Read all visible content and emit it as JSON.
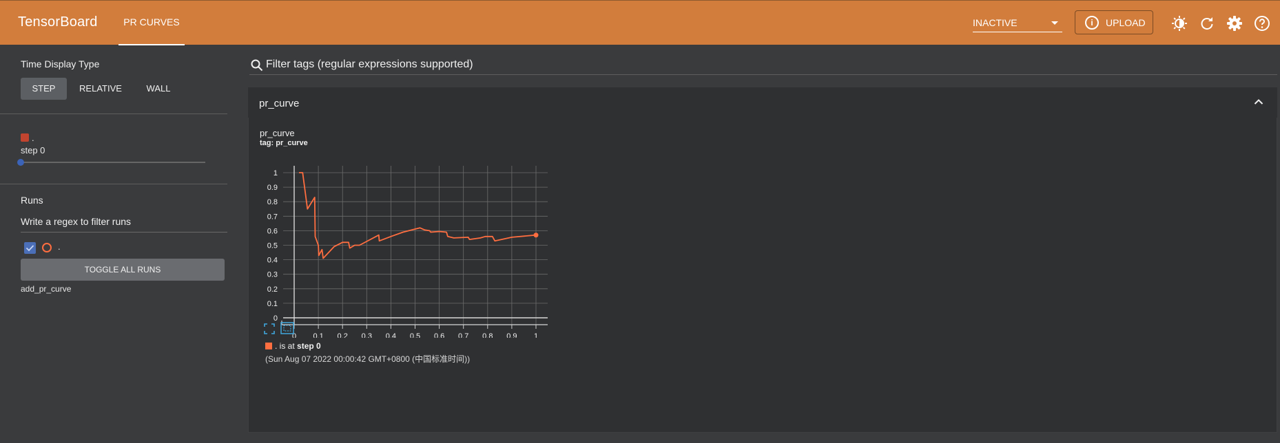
{
  "header": {
    "brand": "TensorBoard",
    "tab_label": "PR CURVES",
    "run_selector_value": "INACTIVE",
    "upload_label": "UPLOAD"
  },
  "sidebar": {
    "time_display_title": "Time Display Type",
    "time_options": [
      "STEP",
      "RELATIVE",
      "WALL"
    ],
    "active_time_option": "STEP",
    "run_name": ".",
    "step_label": "step 0",
    "runs_title": "Runs",
    "filter_runs_placeholder": "Write a regex to filter runs",
    "run_item_label": ".",
    "toggle_all_label": "TOGGLE ALL RUNS",
    "run_group_label": "add_pr_curve"
  },
  "main": {
    "filter_tags_placeholder": "Filter tags (regular expressions supported)",
    "group_title": "pr_curve",
    "card_title": "pr_curve",
    "card_tag": "tag: pr_curve",
    "legend_run": ".",
    "legend_is_at": " is at ",
    "legend_step": "step 0",
    "legend_time": "(Sun Aug 07 2022 00:00:42 GMT+0800 (中国标准时间))"
  },
  "colors": {
    "header": "#d27d3c",
    "series": "#ff6e40",
    "run_swatch": "#c1442f",
    "checkbox": "#4b6fb8"
  },
  "chart_data": {
    "type": "line",
    "xlim": [
      0,
      1
    ],
    "ylim": [
      0,
      1
    ],
    "x_ticks": [
      "0",
      "0.1",
      "0.2",
      "0.3",
      "0.4",
      "0.5",
      "0.6",
      "0.7",
      "0.8",
      "0.9",
      "1"
    ],
    "y_ticks": [
      "0",
      "0.1",
      "0.2",
      "0.3",
      "0.4",
      "0.5",
      "0.6",
      "0.7",
      "0.8",
      "0.9",
      "1"
    ],
    "grid": true,
    "series": [
      {
        "points": [
          [
            0.02,
            1.0
          ],
          [
            0.035,
            1.0
          ],
          [
            0.055,
            0.75
          ],
          [
            0.085,
            0.83
          ],
          [
            0.087,
            0.56
          ],
          [
            0.1,
            0.5
          ],
          [
            0.102,
            0.43
          ],
          [
            0.115,
            0.47
          ],
          [
            0.12,
            0.41
          ],
          [
            0.165,
            0.49
          ],
          [
            0.2,
            0.52
          ],
          [
            0.225,
            0.52
          ],
          [
            0.23,
            0.48
          ],
          [
            0.25,
            0.5
          ],
          [
            0.27,
            0.5
          ],
          [
            0.35,
            0.57
          ],
          [
            0.352,
            0.53
          ],
          [
            0.4,
            0.56
          ],
          [
            0.45,
            0.59
          ],
          [
            0.52,
            0.62
          ],
          [
            0.54,
            0.605
          ],
          [
            0.56,
            0.6
          ],
          [
            0.565,
            0.59
          ],
          [
            0.6,
            0.595
          ],
          [
            0.63,
            0.59
          ],
          [
            0.635,
            0.56
          ],
          [
            0.66,
            0.55
          ],
          [
            0.72,
            0.555
          ],
          [
            0.725,
            0.54
          ],
          [
            0.77,
            0.55
          ],
          [
            0.79,
            0.56
          ],
          [
            0.82,
            0.56
          ],
          [
            0.83,
            0.53
          ],
          [
            0.9,
            0.555
          ],
          [
            1.0,
            0.57
          ]
        ],
        "end_point": [
          1.0,
          0.57
        ]
      }
    ]
  }
}
